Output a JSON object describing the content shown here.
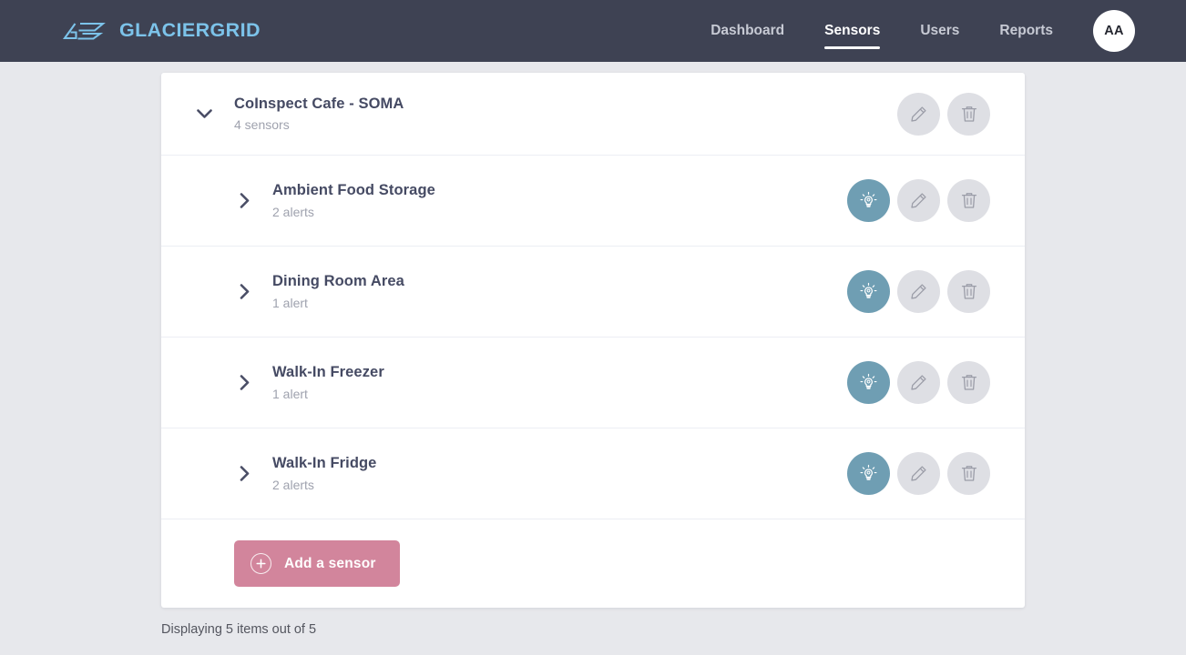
{
  "header": {
    "brand_name": "GLACIERGRID",
    "brand_icon": "glaciergrid-logo-icon",
    "brand_color": "#7cc3ea",
    "background_color": "#3e4253",
    "nav": [
      {
        "label": "Dashboard",
        "active": false
      },
      {
        "label": "Sensors",
        "active": true
      },
      {
        "label": "Users",
        "active": false
      },
      {
        "label": "Reports",
        "active": false
      }
    ],
    "avatar_initials": "AA"
  },
  "main": {
    "group": {
      "name": "CoInspect Cafe - SOMA",
      "sensor_count_label": "4 sensors",
      "expanded": true,
      "chevron_icon": "chevron-down-icon",
      "actions": [
        {
          "icon": "pencil-icon",
          "name": "edit-group-button",
          "style": "gray"
        },
        {
          "icon": "trash-icon",
          "name": "delete-group-button",
          "style": "gray"
        }
      ]
    },
    "sensors": [
      {
        "name": "Ambient Food Storage",
        "alerts_label": "2 alerts",
        "chevron_icon": "chevron-right-icon",
        "actions": [
          {
            "icon": "lightbulb-icon",
            "name": "identify-sensor-button",
            "style": "teal"
          },
          {
            "icon": "pencil-icon",
            "name": "edit-sensor-button",
            "style": "gray"
          },
          {
            "icon": "trash-icon",
            "name": "delete-sensor-button",
            "style": "gray"
          }
        ]
      },
      {
        "name": "Dining Room Area",
        "alerts_label": "1 alert",
        "chevron_icon": "chevron-right-icon",
        "actions": [
          {
            "icon": "lightbulb-icon",
            "name": "identify-sensor-button",
            "style": "teal"
          },
          {
            "icon": "pencil-icon",
            "name": "edit-sensor-button",
            "style": "gray"
          },
          {
            "icon": "trash-icon",
            "name": "delete-sensor-button",
            "style": "gray"
          }
        ]
      },
      {
        "name": "Walk-In Freezer",
        "alerts_label": "1 alert",
        "chevron_icon": "chevron-right-icon",
        "actions": [
          {
            "icon": "lightbulb-icon",
            "name": "identify-sensor-button",
            "style": "teal"
          },
          {
            "icon": "pencil-icon",
            "name": "edit-sensor-button",
            "style": "gray"
          },
          {
            "icon": "trash-icon",
            "name": "delete-sensor-button",
            "style": "gray"
          }
        ]
      },
      {
        "name": "Walk-In Fridge",
        "alerts_label": "2 alerts",
        "chevron_icon": "chevron-right-icon",
        "actions": [
          {
            "icon": "lightbulb-icon",
            "name": "identify-sensor-button",
            "style": "teal"
          },
          {
            "icon": "pencil-icon",
            "name": "edit-sensor-button",
            "style": "gray"
          },
          {
            "icon": "trash-icon",
            "name": "delete-sensor-button",
            "style": "gray"
          }
        ]
      }
    ],
    "add_sensor": {
      "label": "Add a sensor",
      "icon": "plus-circle-icon",
      "color": "#d2859c"
    },
    "results_count": "Displaying 5 items out of 5"
  },
  "colors": {
    "page_background": "#e7e8ec",
    "card_background": "#ffffff",
    "teal_action": "#6f9eb3",
    "gray_action": "#dedfe4",
    "title_text": "#454a63",
    "muted_text": "#9fa2ae"
  }
}
